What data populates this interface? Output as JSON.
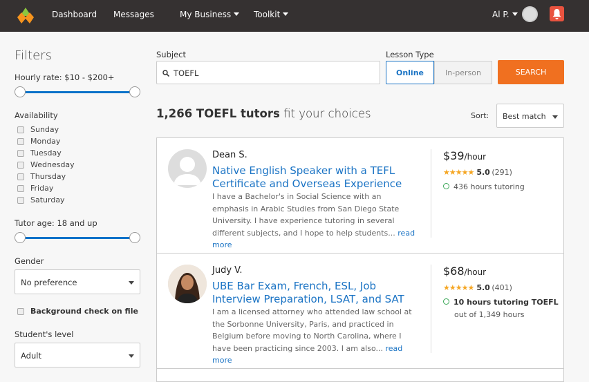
{
  "nav": {
    "items": [
      "Dashboard",
      "Messages",
      "My Business",
      "Toolkit"
    ],
    "user": "Al P."
  },
  "filters": {
    "title": "Filters",
    "hourly_label": "Hourly rate:",
    "hourly_value": "$10 - $200+",
    "hourly_range": [
      0,
      1
    ],
    "availability_label": "Availability",
    "days": [
      "Sunday",
      "Monday",
      "Tuesday",
      "Wednesday",
      "Thursday",
      "Friday",
      "Saturday"
    ],
    "age_label": "Tutor age:",
    "age_value": "18 and up",
    "age_range": [
      0,
      1
    ],
    "gender_label": "Gender",
    "gender_value": "No preference",
    "background_check": "Background check on file",
    "level_label": "Student's level",
    "level_value": "Adult"
  },
  "search": {
    "subject_label": "Subject",
    "subject_value": "TOEFL",
    "lesson_label": "Lesson Type",
    "online": "Online",
    "inperson": "In-person",
    "button": "SEARCH"
  },
  "results": {
    "count": "1,266 TOEFL tutors",
    "suffix": "fit your choices",
    "sort_label": "Sort:",
    "sort_value": "Best match"
  },
  "tutors": [
    {
      "name": "Dean S.",
      "title": "Native English Speaker with a TEFL Certificate and Overseas Experience",
      "desc": "I have a Bachelor's in Social Science with an emphasis in Arabic Studies from San Diego State University. I have experience tutoring in several different subjects, and I hope to help students...",
      "more": "read more",
      "price": "$39",
      "unit": "/hour",
      "rating": "5.0",
      "reviews": "(291)",
      "hours": "436 hours tutoring",
      "hours2": ""
    },
    {
      "name": "Judy V.",
      "title": "UBE Bar Exam, French, ESL, Job Interview Preparation, LSAT, and SAT",
      "desc": "I am a licensed attorney who attended law school at the Sorbonne University, Paris, and practiced in Belgium before moving to North Carolina, where I have been practicing since 2003. I am also...",
      "more": "read more",
      "price": "$68",
      "unit": "/hour",
      "rating": "5.0",
      "reviews": "(401)",
      "hours": "10 hours tutoring TOEFL",
      "hours2": "out of 1,349 hours"
    }
  ],
  "colors": {
    "nav": "#353131",
    "accent": "#f07020",
    "link": "#1a73c4",
    "alert": "#e9533f"
  }
}
